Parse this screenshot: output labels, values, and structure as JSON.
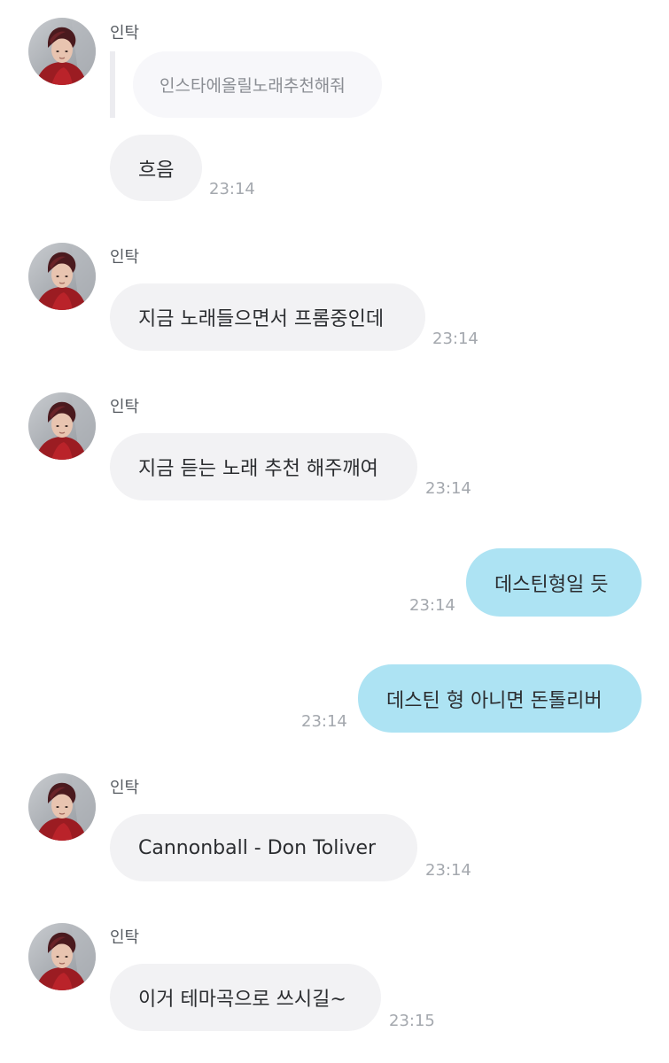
{
  "chat": {
    "sender_name": "인탁",
    "messages": [
      {
        "quoted_text": "인스타에올릴노래추천해줘",
        "text": "흐음",
        "time": "23:14"
      },
      {
        "text": "지금 노래들으면서 프롬중인데",
        "time": "23:14"
      },
      {
        "text": "지금 듣는 노래 추천 해주깨여",
        "time": "23:14"
      },
      {
        "text": "데스틴형일 듯",
        "time": "23:14"
      },
      {
        "text": "데스틴 형 아니면 돈톨리버",
        "time": "23:14"
      },
      {
        "text": "Cannonball - Don Toliver",
        "time": "23:14"
      },
      {
        "text": "이거 테마곡으로 쓰시길~",
        "time": "23:15"
      }
    ]
  },
  "colors": {
    "incoming_bubble": "#f2f2f4",
    "outgoing_bubble": "#ade3f3",
    "timestamp": "#a4a8ae"
  }
}
